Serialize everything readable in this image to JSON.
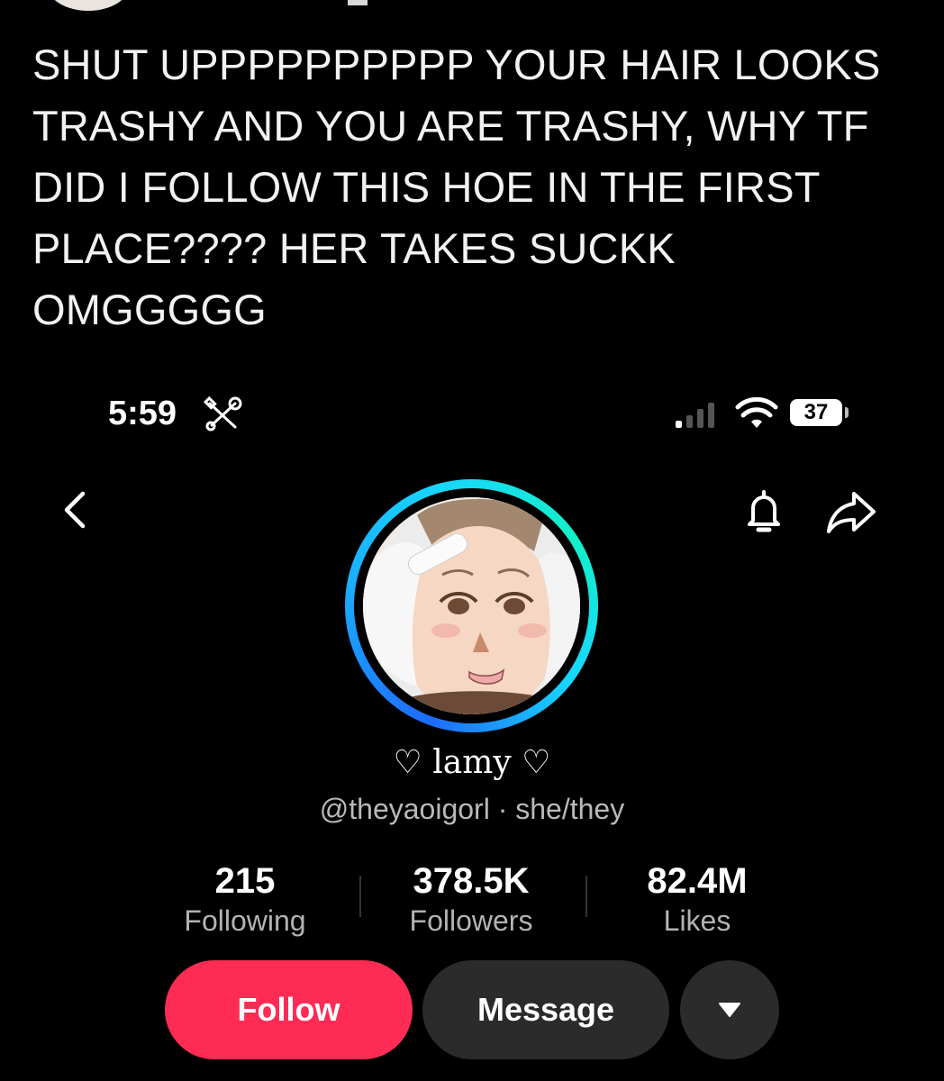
{
  "post": {
    "text": "SHUT UPPPPPPPPPP YOUR HAIR LOOKS TRASHY AND YOU ARE TRASHY, WHY TF DID I FOLLOW THIS HOE IN THE FIRST PLACE???? HER TAKES SUCKK OMGGGGG"
  },
  "status_bar": {
    "time": "5:59",
    "tools_icon": "wrench-screwdriver-icon",
    "signal_icon": "cellular-signal-icon",
    "wifi_icon": "wifi-icon",
    "battery_level": "37"
  },
  "header": {
    "back_icon": "chevron-left-icon",
    "bell_icon": "bell-icon",
    "share_icon": "share-arrow-icon"
  },
  "profile": {
    "display_name": "♡ lamy ♡",
    "handle_line": "@theyaoigorl · she/they",
    "ring_colors": [
      "#1e6bff",
      "#18d6ff",
      "#13f0c8"
    ]
  },
  "stats": [
    {
      "value": "215",
      "label": "Following"
    },
    {
      "value": "378.5K",
      "label": "Followers"
    },
    {
      "value": "82.4M",
      "label": "Likes"
    }
  ],
  "actions": {
    "follow_label": "Follow",
    "message_label": "Message",
    "more_icon": "caret-down-icon",
    "follow_color": "#fe2c55"
  }
}
